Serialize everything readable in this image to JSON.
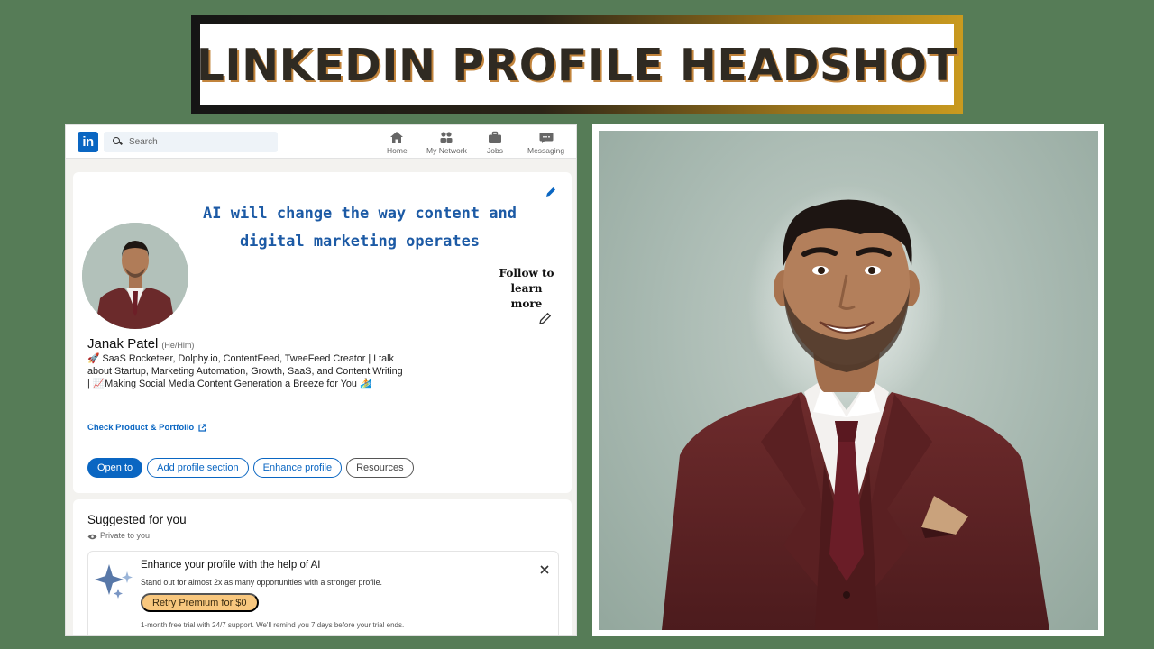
{
  "banner": {
    "title": "LINKEDIN PROFILE HEADSHOT"
  },
  "linkedin": {
    "logo": "in",
    "search": {
      "placeholder": "Search"
    },
    "nav": [
      {
        "label": "Home",
        "icon": "home-icon"
      },
      {
        "label": "My Network",
        "icon": "network-icon"
      },
      {
        "label": "Jobs",
        "icon": "briefcase-icon"
      },
      {
        "label": "Messaging",
        "icon": "messaging-icon"
      }
    ],
    "banner_text": {
      "line1": "AI will change the way content and",
      "line2": "digital marketing operates",
      "follow1": "Follow to",
      "follow2": "learn more"
    },
    "profile": {
      "name": "Janak Patel",
      "pronouns": "(He/Him)",
      "headline": "🚀 SaaS Rocketeer, Dolphy.io, ContentFeed, TweeFeed Creator | I talk about Startup, Marketing Automation, Growth, SaaS, and Content Writing | 📈Making Social Media Content Generation a Breeze for You 🏄",
      "portfolio_link": "Check Product & Portfolio"
    },
    "buttons": {
      "open_to": "Open to",
      "add_section": "Add profile section",
      "enhance": "Enhance profile",
      "resources": "Resources"
    },
    "suggested": {
      "title": "Suggested for you",
      "private": "Private to you",
      "ai_title": "Enhance your profile with the help of AI",
      "ai_desc": "Stand out for almost 2x as many opportunities with a stronger profile.",
      "premium_button": "Retry Premium for $0",
      "trial_note": "1-month free trial with 24/7 support. We'll remind you 7 days before your trial ends."
    }
  },
  "colors": {
    "background": "#567c57",
    "linkedin_blue": "#0a66c2",
    "banner_text": "#1c5aa5",
    "premium": "#f8c77e",
    "suit": "#6b2a2b"
  }
}
